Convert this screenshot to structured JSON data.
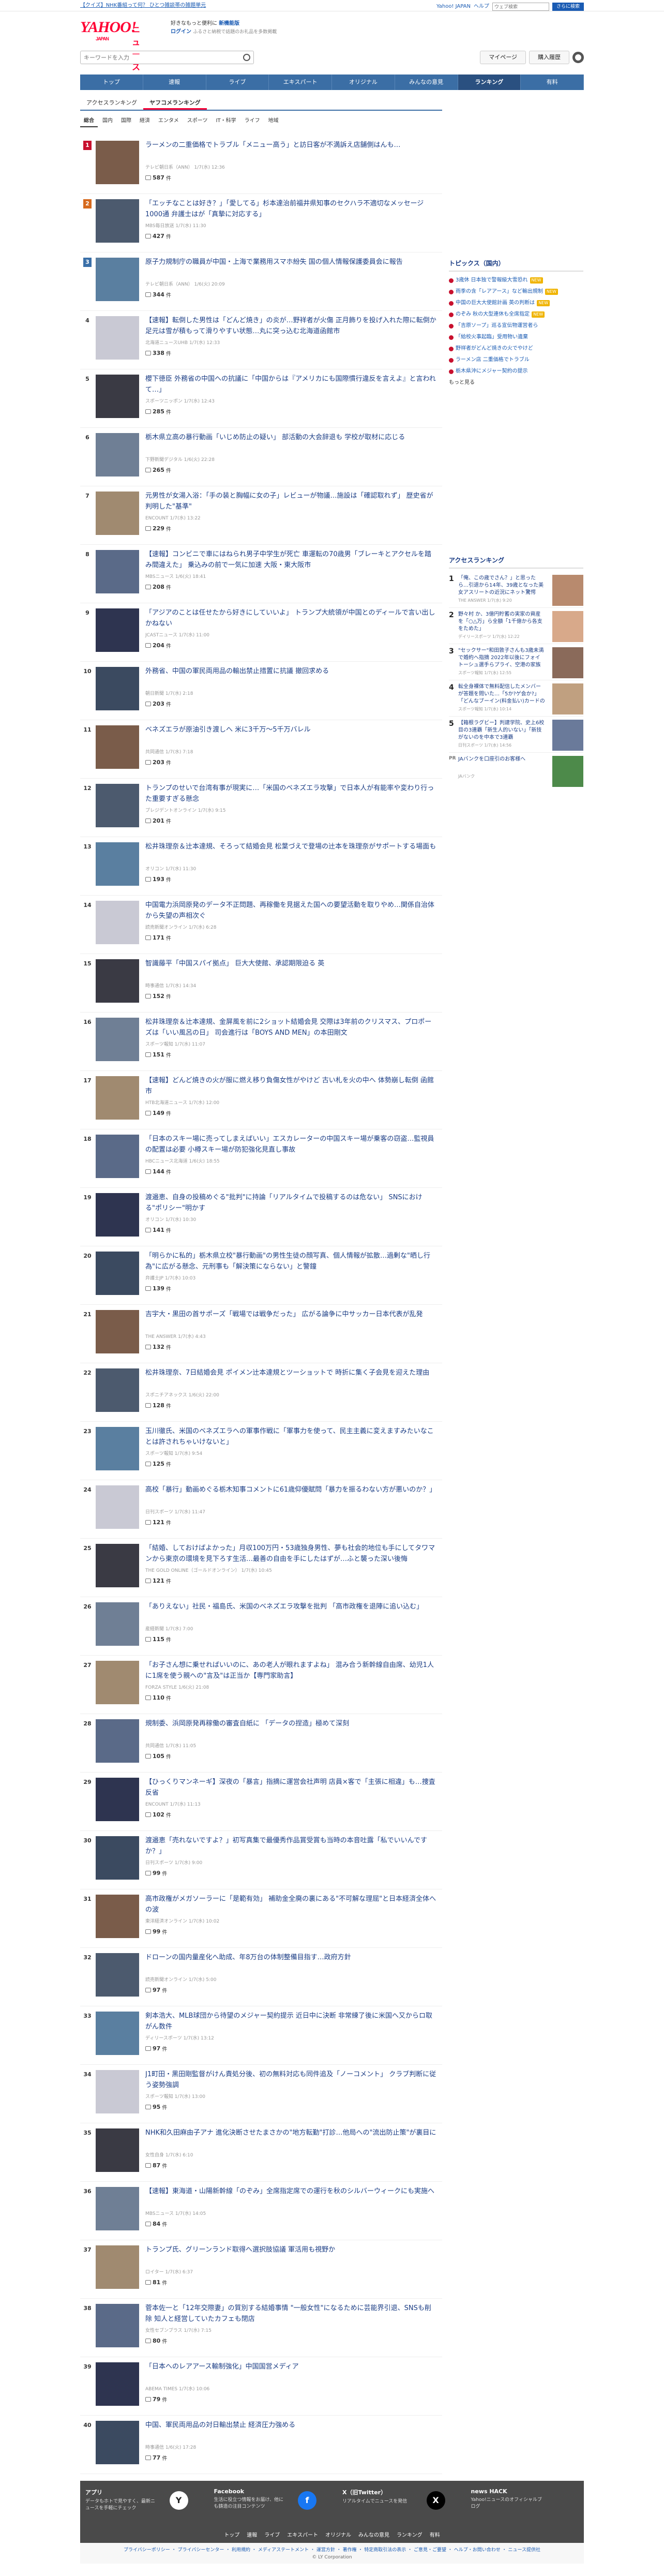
{
  "top_notice": {
    "text": "【クイズ】NHK番組って何？ ひとつ雑談帯の雑題単元",
    "links": [
      "Yahoo! JAPAN",
      "ヘルプ"
    ],
    "search_placeholder": "ウェブ検索",
    "search_button": "さらに検索"
  },
  "header": {
    "logo": "YAHOO!",
    "logo_news": "ニュース",
    "logo_sub": "JAPAN",
    "promo_line1": "好きなもっと便利に",
    "promo_bold": "新機能版",
    "promo_line2": "ログイン",
    "promo_line3": "ふるさと納税で話題のお礼品を多数掲載"
  },
  "search": {
    "placeholder": "キーワードを入力",
    "mypage": "マイページ",
    "purchase": "購入履歴"
  },
  "global_nav": [
    "トップ",
    "速報",
    "ライブ",
    "エキスパート",
    "オリジナル",
    "みんなの意見",
    "ランキング",
    "有料"
  ],
  "tabs": [
    "アクセスランキング",
    "ヤフコメランキング"
  ],
  "subtabs": [
    "総合",
    "国内",
    "国際",
    "経済",
    "エンタメ",
    "スポーツ",
    "IT・科学",
    "ライフ",
    "地域"
  ],
  "ranking": [
    {
      "rank": "1",
      "title": "ラーメンの二重価格でトラブル「メニュー高う」と訪日客が不満訴え店舗側はんも…",
      "meta": "テレビ朝日系（ANN） 1/7(水) 12:36",
      "comments": "587"
    },
    {
      "rank": "2",
      "title": "「エッチなことは好き？」「愛してる」杉本達治前福井県知事のセクハラ不適切なメッセージ1000通 弁護士はが「真摯に対応する」",
      "meta": "MBS毎日放送 1/7(水) 11:30",
      "comments": "427"
    },
    {
      "rank": "3",
      "title": "原子力規制庁の職員が中国・上海で業務用スマホ紛失 国の個人情報保護委員会に報告",
      "meta": "テレビ朝日系（ANN） 1/6(火) 20:09",
      "comments": "344"
    },
    {
      "rank": "4",
      "title": "【速報】転倒した男性は「どんど焼き」の炎が…野祥者が火傷 正月飾りを投げ入れた際に転倒か 足元は雪が積もって滑りやすい状態…丸に突っ込む北海道函館市",
      "meta": "北海道ニュースUHB 1/7(水) 12:33",
      "comments": "338"
    },
    {
      "rank": "5",
      "title": "櫻下徳臣 外務省の中国への抗議に「中国からは『アメリカにも国際慣行違反を言えよ』と言われて…」",
      "meta": "スポーツニッポン 1/7(水) 12:43",
      "comments": "285"
    },
    {
      "rank": "6",
      "title": "栃木県立高の暴行動画「いじめ防止の疑い」 部活動の大会辞退も 学校が取材に応じる",
      "meta": "下野新聞デジタル 1/6(火) 22:28",
      "comments": "265"
    },
    {
      "rank": "7",
      "title": "元男性が女湯入浴：「手の装と胸幅に女の子」レビューが物議…施設は「確認取れず」 歴史省が判明した\"基準\"",
      "meta": "ENCOUNT 1/7(水) 13:22",
      "comments": "229"
    },
    {
      "rank": "8",
      "title": "【速報】コンビニで車にはねられ男子中学生が死亡 車運転の70歳男「ブレーキとアクセルを踏み間違えた」 乗込みの前で一気に加速 大阪・東大阪市",
      "meta": "MBSニュース 1/6(火) 18:41",
      "comments": "208"
    },
    {
      "rank": "9",
      "title": "「アジアのことは任せたから好きにしていいよ」 トランプ大統領が中国とのディールで言い出しかねない",
      "meta": "JCASTニュース 1/7(水) 11:00",
      "comments": "204"
    },
    {
      "rank": "10",
      "title": "外務省、中国の軍民両用品の輸出禁止措置に抗議 撤回求める",
      "meta": "朝日新聞 1/7(水) 2:18",
      "comments": "203"
    },
    {
      "rank": "11",
      "title": "ベネズエラが原油引き渡しへ 米に3千万～5千万バレル",
      "meta": "共同通信 1/7(水) 7:18",
      "comments": "203"
    },
    {
      "rank": "12",
      "title": "トランプのせいで台湾有事が現実に…「米国のベネズエラ攻撃」で日本人が有能率や変わり行った重要すぎる懸念",
      "meta": "プレジデントオンライン 1/7(水) 9:15",
      "comments": "201"
    },
    {
      "rank": "13",
      "title": "松井珠理奈＆辻本達規、そろって結婚会見 松葉づえで登場の辻本を珠理奈がサポートする場面も",
      "meta": "オリコン 1/7(水) 11:30",
      "comments": "193"
    },
    {
      "rank": "14",
      "title": "中国電力浜岡原発のデータ不正問題、再稼働を見据えた国への要望活動を取りやめ…関係自治体から失望の声相次ぐ",
      "meta": "読売新聞オンライン 1/7(水) 6:28",
      "comments": "171"
    },
    {
      "rank": "15",
      "title": "智識藤平「中国スパイ拠点」 巨大大使館、承認期限迫る 英",
      "meta": "時事通信 1/7(水) 14:34",
      "comments": "152"
    },
    {
      "rank": "16",
      "title": "松井珠理奈＆辻本達規、金屏風を前に2ショット結婚会見 交際は3年前のクリスマス、プロポーズは「いい風呂の日」 司会進行は「BOYS AND MEN」の本田剛文",
      "meta": "スポーツ報知 1/7(水) 11:07",
      "comments": "151"
    },
    {
      "rank": "17",
      "title": "【速報】どんど焼きの火が服に燃え移り負傷女性がやけど 古い札を火の中へ 体勢崩し転倒 函館市",
      "meta": "HTB北海道ニュース 1/7(水) 12:00",
      "comments": "149"
    },
    {
      "rank": "18",
      "title": "「日本のスキー場に売ってしまえばいい」エスカレーターの中国スキー場が乗客の窃盗…監視員の配置は必要 小樽スキー場が防犯強化見直し事故",
      "meta": "HBCニュース北海道 1/6(火) 18:55",
      "comments": "144"
    },
    {
      "rank": "19",
      "title": "渡邉恵、自身の投稿めぐる\"批判\"に持論「リアルタイムで投稿するのは危ない」 SNSにおける\"ポリシー\"明かす",
      "meta": "オリコン 1/7(水) 10:30",
      "comments": "141"
    },
    {
      "rank": "20",
      "title": "「明らかに私的」栃木県立校\"暴行動画\"の男性生徒の顔写真、個人情報が拡散…過剰な\"晒し行為\"に広がる懸念、元刑事も「解決策にならない」と警鐘",
      "meta": "弁護士JP 1/7(水) 10:03",
      "comments": "139"
    },
    {
      "rank": "21",
      "title": "吉宇大・黒田の首サポーズ「戦場では戦争だった」 広がる論争に中サッカー日本代表が乱発",
      "meta": "THE ANSWER 1/7(水) 4:43",
      "comments": "132"
    },
    {
      "rank": "22",
      "title": "松井珠理奈、7日結婚会見 ポイメン辻本達規とツーショットで 時折に集く子会見を迎えた理由",
      "meta": "スポニチアネックス 1/6(火) 22:00",
      "comments": "128"
    },
    {
      "rank": "23",
      "title": "玉川徹氏、米国のベネズエラへの軍事作戦に「軍事力を使って、民主主義に変えますみたいなことは許されちゃいけないと」",
      "meta": "スポーツ報知 1/7(水) 9:54",
      "comments": "125"
    },
    {
      "rank": "24",
      "title": "高校「暴行」動画めぐる栃木知事コメントに61歳仰優賦問「暴力を振るわない方が悪いのか？」",
      "meta": "日刊スポーツ 1/7(水) 11:47",
      "comments": "121"
    },
    {
      "rank": "25",
      "title": "「結婚、しておけばよかった」月収100万円・53歳独身男性、夢も社会的地位も手にしてタワマンから東京の環境を見下ろす生活…最善の自由を手にしたはずが…ふと襲った深い後悔",
      "meta": "THE GOLD ONLINE（ゴールドオンライン） 1/7(水) 10:45",
      "comments": "121"
    },
    {
      "rank": "26",
      "title": "「ありえない」社民・福島氏、米国のベネズエラ攻撃を批判 「高市政権を退陣に追い込む」",
      "meta": "産経新聞 1/7(水) 7:00",
      "comments": "115"
    },
    {
      "rank": "27",
      "title": "「お子さん想に乗せればいいのに、あの老人が眼れますよね」 混み合う新幹線自由席、幼児1人に1席を使う親への\"言及\"は正当か【専門家助言】",
      "meta": "FORZA STYLE 1/6(火) 21:08",
      "comments": "110"
    },
    {
      "rank": "28",
      "title": "規制委、浜岡原発再稼働の審査自紙に 「データの捏造」極めて深刻",
      "meta": "共同通信 1/7(水) 11:05",
      "comments": "105"
    },
    {
      "rank": "29",
      "title": "【ひっくりマンネーギ】深夜の「暴言」指摘に運営会社声明 店員×客で「主張に相違」も…捜査反省",
      "meta": "ENCOUNT 1/7(水) 11:13",
      "comments": "102"
    },
    {
      "rank": "30",
      "title": "渡邉恵「売れないですよ？」初写真集で最優秀作品賞受賞も当時の本音吐露「私でいいんですか？」",
      "meta": "日刊スポーツ 1/7(水) 9:00",
      "comments": "99"
    },
    {
      "rank": "31",
      "title": "高市政権がメガソーラーに「是範有効」 補助金全廃の裏にある\"不可解な理屈\"と日本経済全体への波",
      "meta": "東洋経済オンライン 1/7(水) 10:02",
      "comments": "99"
    },
    {
      "rank": "32",
      "title": "ドローンの国内量産化へ助成、年8万台の体制整備目指す…政府方針",
      "meta": "読売新聞オンライン 1/7(水) 5:00",
      "comments": "97"
    },
    {
      "rank": "33",
      "title": "剣本浩大、MLB球団から待望のメジャー契約提示 近日中に決断 非常練了後に米国へ又からロ取がん数件",
      "meta": "ディリースポーツ 1/7(水) 13:12",
      "comments": "97"
    },
    {
      "rank": "34",
      "title": "J1町田・黒田剛監督がけん責処分後、初の無料対応も同件追及「ノーコメント」 クラブ判断に従う姿勢強調",
      "meta": "スポーツ報知 1/7(水) 13:00",
      "comments": "95"
    },
    {
      "rank": "35",
      "title": "NHK和久田麻由子アナ 進化決断させたまさかの\"地方転勤\"打診…他局への\"流出防止策\"が裏目に",
      "meta": "女性自身 1/7(水) 6:10",
      "comments": "87"
    },
    {
      "rank": "36",
      "title": "【速報】東海道・山陽新幹線「のぞみ」全席指定席での運行を秋のシルバーウィークにも実施へ",
      "meta": "MBSニュース 1/7(水) 14:05",
      "comments": "84"
    },
    {
      "rank": "37",
      "title": "トランプ氏、グリーンランド取得へ選択肢協議 軍活用も視野か",
      "meta": "ロイター 1/7(水) 6:37",
      "comments": "81"
    },
    {
      "rank": "38",
      "title": "菅本佐一と「12年交際妻」の質別する結婚事情 \"一般女性\"になるために芸能界引退、SNSも削除 知人と経営していたカフェも閉店",
      "meta": "女性セブンプラス 1/7(水) 7:15",
      "comments": "80"
    },
    {
      "rank": "39",
      "title": "「日本へのレアアース輸制強化」中国国営メディア",
      "meta": "ABEMA TIMES 1/7(水) 10:06",
      "comments": "79"
    },
    {
      "rank": "40",
      "title": "中国、軍民両用品の対日輸出禁止 経済圧力強める",
      "meta": "時事通信 1/6(火) 17:28",
      "comments": "77"
    }
  ],
  "topics": {
    "title": "トピックス（国内）",
    "items": [
      {
        "text": "3歳休 日本独で警報級大雪恐れ",
        "badge": "NEW"
      },
      {
        "text": "雨季の含「レアアース」など輸出規制",
        "badge": "NEW"
      },
      {
        "text": "中国の巨大大使館計画 英の判断は",
        "badge": "NEW"
      },
      {
        "text": "のぞみ 秋の大型連休も全席指定",
        "badge": "NEW"
      },
      {
        "text": "「吉原ソープ」巡る宣伝物運営者ら",
        "badge": ""
      },
      {
        "text": "「給校火事起臨」受用物い遺棄",
        "badge": ""
      },
      {
        "text": "野祥者がどんど焼きの火でやけど",
        "badge": ""
      },
      {
        "text": "ラーメン店 二重価格でトラブル",
        "badge": ""
      },
      {
        "text": "栃木県沖にメジャー契約の提示",
        "badge": ""
      }
    ],
    "more": "もっと見る"
  },
  "access_ranking": {
    "title": "アクセスランキング",
    "items": [
      {
        "rank": "1",
        "title": "「俺、この歳でさん？」と思ったら…引退から14年、39歳となった美女アスリートの近況にネット驚愕「放送された」「結婚報告」",
        "meta": "THE ANSWER 1/7(水) 9:20"
      },
      {
        "rank": "2",
        "title": "野々村 か、3億円貯蓄の実家の資産を「○△万」ら全額「1千億から各支をためた」",
        "meta": "デイリースポーツ 1/7(水) 12:22"
      },
      {
        "rank": "3",
        "title": "\"セックサー\"和田敦子さんも3歳未満で婚約へ指摘 2022年以後にフォイトーシュ選手らプライ、空港の家族も注意的に訴える",
        "meta": "スポーツ報知 1/7(水) 12:55"
      },
      {
        "rank": "4",
        "title": "転全身裸体で無料配信したメンバーが答題を問いた…「5か?ゲ会か?」「どんなブーイン(料金払い)カードの方法…",
        "meta": "スポーツ報知 1/7(水) 10:14"
      },
      {
        "rank": "5",
        "title": "【箱根ラグビー】判建学院、史上6校目の3連覇「新生人的いない」「新技がないのを中本で3連覇",
        "meta": "日刊スポーツ 1/7(水) 14:56"
      }
    ],
    "pr": {
      "label": "PR",
      "title": "JAバンクを口座引のお客様へ",
      "meta": "JAバンク"
    }
  },
  "footer": {
    "app_title": "アプリ",
    "app_desc": "データもホトで見やすく、最新ニュースを手軽にチェック",
    "fb_title": "Facebook",
    "fb_desc": "生活に役立つ情報をお届け、他にも鋳造の注目コンテンツ",
    "x_title": "X（旧Twitter）",
    "x_desc": "リアルタイムでニュースを発信",
    "hack_title": "news HACK",
    "hack_desc": "Yahoo!ニュースのオフィシャルブログ",
    "nav": [
      "トップ",
      "速報",
      "ライブ",
      "エキスパート",
      "オリジナル",
      "みんなの意見",
      "ランキング",
      "有料"
    ],
    "legal": "プライバシーポリシー ・ プライバシーセンター ・ 利用規約 ・ メディアステートメント ・ 運営方針 ・ 著作権 ・ 特定商取引法の表示 ・ ご意見・ご要望 ・ ヘルプ・お問い合わせ ・ ニュース提供社",
    "copyright": "© LY Corporation"
  }
}
